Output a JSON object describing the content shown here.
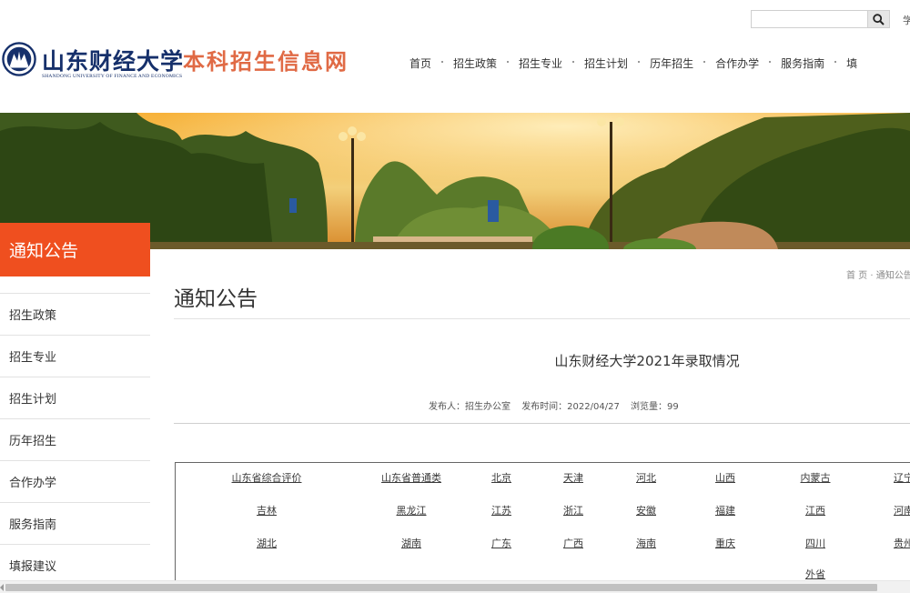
{
  "header": {
    "logo_cn": "山东财经大学",
    "logo_en": "SHANDONG UNIVERSITY OF FINANCE AND ECONOMICS",
    "site_name": "本科招生信息网",
    "search_placeholder": "",
    "top_link": "学"
  },
  "nav": [
    "首页",
    "招生政策",
    "招生专业",
    "招生计划",
    "历年招生",
    "合作办学",
    "服务指南",
    "填"
  ],
  "sidebar": {
    "title": "通知公告",
    "items": [
      "招生政策",
      "招生专业",
      "招生计划",
      "历年招生",
      "合作办学",
      "服务指南",
      "填报建议"
    ]
  },
  "breadcrumb": "首 页 · 通知公告",
  "page_title": "通知公告",
  "article": {
    "title": "山东财经大学2021年录取情况",
    "publisher": "发布人：招生办公室",
    "date": "发布时间：2022/04/27",
    "views": "浏览量：99"
  },
  "regions": {
    "row1": [
      "山东省综合评价",
      "山东省普通类",
      "北京",
      "天津",
      "河北",
      "山西",
      "内蒙古",
      "辽宁"
    ],
    "row2": [
      "吉林",
      "黑龙江",
      "江苏",
      "浙江",
      "安徽",
      "福建",
      "江西",
      "河南"
    ],
    "row3": [
      "湖北",
      "湖南",
      "广东",
      "广西",
      "海南",
      "重庆",
      "四川",
      "贵州"
    ],
    "row4": [
      "外省"
    ]
  },
  "colors": {
    "accent": "#ef4f1f",
    "logo_blue": "#16306b",
    "site_name_orange": "#e06a45"
  }
}
